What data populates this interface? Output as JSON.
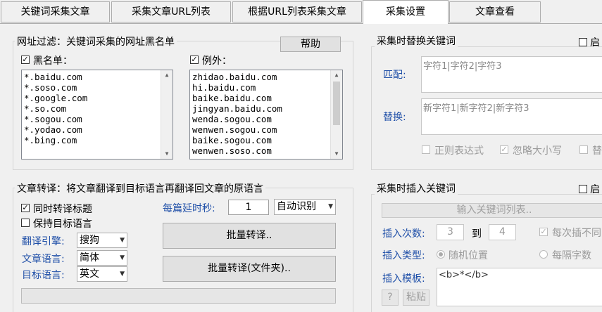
{
  "tabs": [
    "关键词采集文章",
    "采集文章URL列表",
    "根据URL列表采集文章",
    "采集设置",
    "文章查看"
  ],
  "url_filter": {
    "group_title": "网址过滤：关键词采集的网址黑名单",
    "help_button": "帮助",
    "blacklist_label": "黑名单：",
    "blacklist_checked": true,
    "blacklist": [
      "*.baidu.com",
      "*.soso.com",
      "*.google.com",
      "*.so.com",
      "*.sogou.com",
      "*.yodao.com",
      "*.bing.com"
    ],
    "exception_label": "例外：",
    "exception_checked": true,
    "exceptions": [
      "zhidao.baidu.com",
      "hi.baidu.com",
      "baike.baidu.com",
      "jingyan.baidu.com",
      "wenda.sogou.com",
      "wenwen.sogou.com",
      "baike.sogou.com",
      "wenwen.soso.com"
    ]
  },
  "translate": {
    "group_title": "文章转译：将文章翻译到目标语言再翻译回文章的原语言",
    "translate_title_label": "同时转译标题",
    "translate_title_checked": true,
    "keep_target_label": "保持目标语言",
    "keep_target_checked": false,
    "engine_label": "翻译引擎:",
    "engine_value": "搜狗",
    "article_lang_label": "文章语言:",
    "article_lang_value": "简体",
    "target_lang_label": "目标语言:",
    "target_lang_value": "英文",
    "delay_label": "每篇延时秒:",
    "delay_value": "1",
    "detect_value": "自动识别",
    "batch_button": "批量转译..",
    "batch_folder_button": "批量转译(文件夹)..",
    "progress": 0
  },
  "replace": {
    "group_title": "采集时替换关键词",
    "enable_label": "启",
    "match_label": "匹配:",
    "match_placeholder": "字符1|字符2|字符3",
    "replace_label": "替换:",
    "replace_placeholder": "新字符1|新字符2|新字符3",
    "regex_label": "正则表达式",
    "ignore_case_label": "忽略大小写",
    "ignore_case_checked": true,
    "extra_label": "替"
  },
  "insert": {
    "group_title": "采集时插入关键词",
    "enable_label": "启",
    "input_list_button": "输入关键词列表..",
    "count_label": "插入次数:",
    "count_from": "3",
    "to_label": "到",
    "count_to": "4",
    "no_repeat_label": "每次插不同",
    "no_repeat_checked": true,
    "type_label": "插入类型:",
    "random_label": "随机位置",
    "interval_label": "每隔字数",
    "template_label": "插入模板:",
    "template_value": "<b>*</b>",
    "help_button": "?",
    "paste_button": "粘贴"
  }
}
